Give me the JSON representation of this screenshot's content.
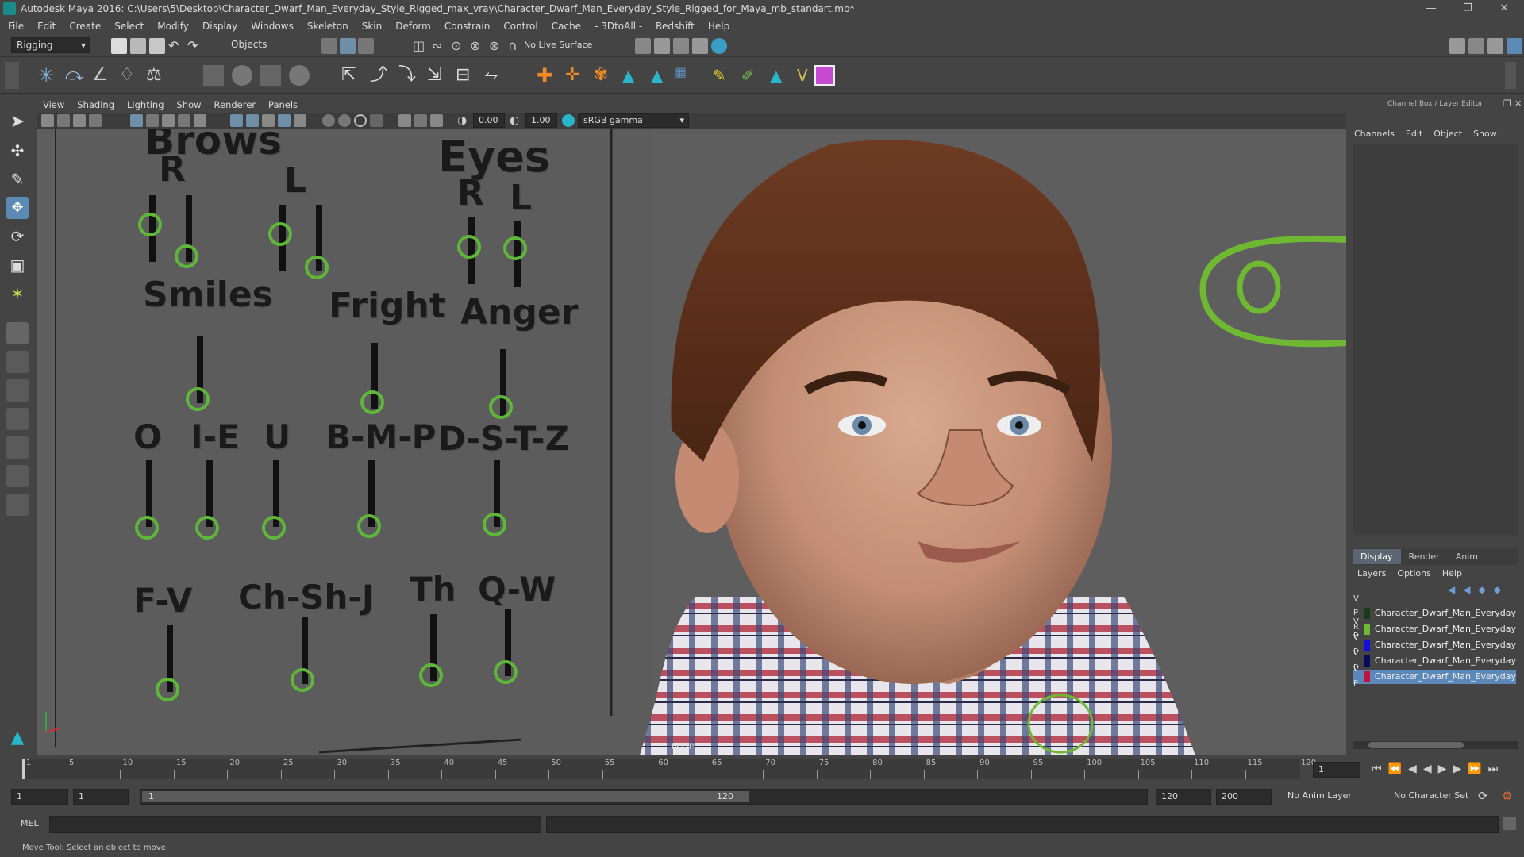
{
  "titlebar": {
    "title": "Autodesk Maya 2016: C:\\Users\\5\\Desktop\\Character_Dwarf_Man_Everyday_Style_Rigged_max_vray\\Character_Dwarf_Man_Everyday_Style_Rigged_for_Maya_mb_standart.mb*"
  },
  "menubar": [
    "File",
    "Edit",
    "Create",
    "Select",
    "Modify",
    "Display",
    "Windows",
    "Skeleton",
    "Skin",
    "Deform",
    "Constrain",
    "Control",
    "Cache",
    "- 3DtoAll -",
    "Redshift",
    "Help"
  ],
  "statusline": {
    "menuset": "Rigging",
    "selmode": "Objects",
    "live_surface": "No Live Surface"
  },
  "panel": {
    "menus": [
      "View",
      "Shading",
      "Lighting",
      "Show",
      "Renderer",
      "Panels"
    ],
    "exposure": "0.00",
    "gamma": "1.00",
    "colorspace": "sRGB gamma",
    "camera": "persp"
  },
  "face_rig": {
    "headers": [
      "Brows",
      "Eyes"
    ],
    "brow_r": "R",
    "brow_l": "L",
    "eye_r": "R",
    "eye_l": "L",
    "smiles": "Smiles",
    "fright": "Fright",
    "anger": "Anger",
    "o": "O",
    "ie": "I-E",
    "u": "U",
    "bmp": "B-M-P",
    "dstz": "D-S-T-Z",
    "fv": "F-V",
    "chshj": "Ch-Sh-J",
    "th": "Th",
    "qw": "Q-W"
  },
  "channelbox": {
    "header": "Channel Box / Layer Editor",
    "tabs": [
      "Channels",
      "Edit",
      "Object",
      "Show"
    ],
    "layer_tabs": [
      "Display",
      "Render",
      "Anim"
    ],
    "layer_menus": [
      "Layers",
      "Options",
      "Help"
    ],
    "layers": [
      {
        "flags": "V P R",
        "name": "Character_Dwarf_Man_Everyday",
        "color": "#1a3a1a"
      },
      {
        "flags": "V P",
        "name": "Character_Dwarf_Man_Everyday",
        "color": "#6fb832"
      },
      {
        "flags": "V P",
        "name": "Character_Dwarf_Man_Everyday",
        "color": "#1010e0"
      },
      {
        "flags": "V P",
        "name": "Character_Dwarf_Man_Everyday",
        "color": "#0a0a5a"
      },
      {
        "flags": "V P",
        "name": "Character_Dwarf_Man_Everyday",
        "color": "#c0143c",
        "selected": true
      }
    ]
  },
  "timeline": {
    "ticks": [
      "1",
      "5",
      "10",
      "15",
      "20",
      "25",
      "30",
      "35",
      "40",
      "45",
      "50",
      "55",
      "60",
      "65",
      "70",
      "75",
      "80",
      "85",
      "90",
      "95",
      "100",
      "105",
      "110",
      "115",
      "120"
    ],
    "current_frame": "1"
  },
  "range": {
    "start": "1",
    "playback_start": "1",
    "slider_start": "1",
    "slider_end": "120",
    "playback_end": "120",
    "end": "200",
    "anim_layer": "No Anim Layer",
    "char_set": "No Character Set"
  },
  "cmdline": {
    "label": "MEL"
  },
  "helpline": {
    "text": "Move Tool: Select an object to move."
  },
  "colors": {
    "rig_green": "#5fb73a",
    "panel": "#444444",
    "viewport": "#5e5e5e"
  }
}
